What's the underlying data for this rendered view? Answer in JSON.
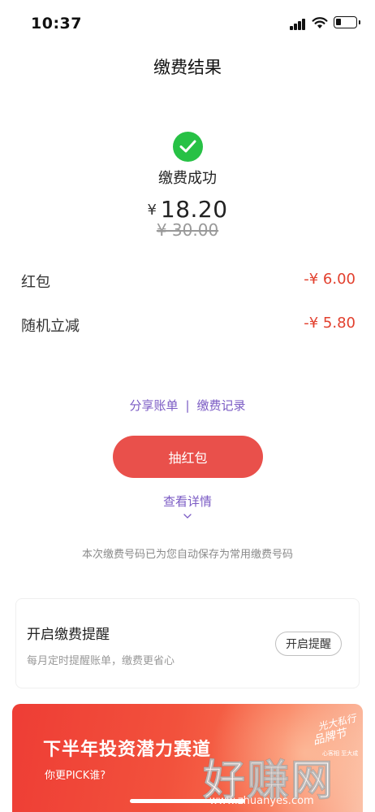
{
  "status_bar": {
    "time": "10:37"
  },
  "page": {
    "title": "缴费结果"
  },
  "result": {
    "status_text": "缴费成功",
    "currency_symbol": "¥",
    "amount": "18.20",
    "original_price": "¥ 30.00"
  },
  "discounts": [
    {
      "label": "红包",
      "value": "-¥ 6.00"
    },
    {
      "label": "随机立减",
      "value": "-¥ 5.80"
    }
  ],
  "links": {
    "share_bill": "分享账单",
    "separator": "|",
    "payment_records": "缴费记录"
  },
  "draw_button": {
    "label": "抽红包"
  },
  "details_link": {
    "label": "查看详情"
  },
  "saved_note": "本次缴费号码已为您自动保存为常用缴费号码",
  "reminder": {
    "title": "开启缴费提醒",
    "subtitle": "每月定时提醒账单，缴费更省心",
    "button_label": "开启提醒"
  },
  "promo": {
    "title": "下半年投资潜力赛道",
    "subtitle": "你更PICK谁?",
    "logo_line1": "光大私行",
    "logo_line2": "品牌节",
    "logo_line3": "心客相 至大成"
  },
  "watermark": {
    "main": "好赚网",
    "sub": "www.zhuanyes.com"
  },
  "colors": {
    "success_green": "#27c145",
    "discount_red": "#e2402e",
    "link_purple": "#7b5bc4",
    "primary_button": "#e9504b",
    "promo_red": "#ee3d35"
  }
}
